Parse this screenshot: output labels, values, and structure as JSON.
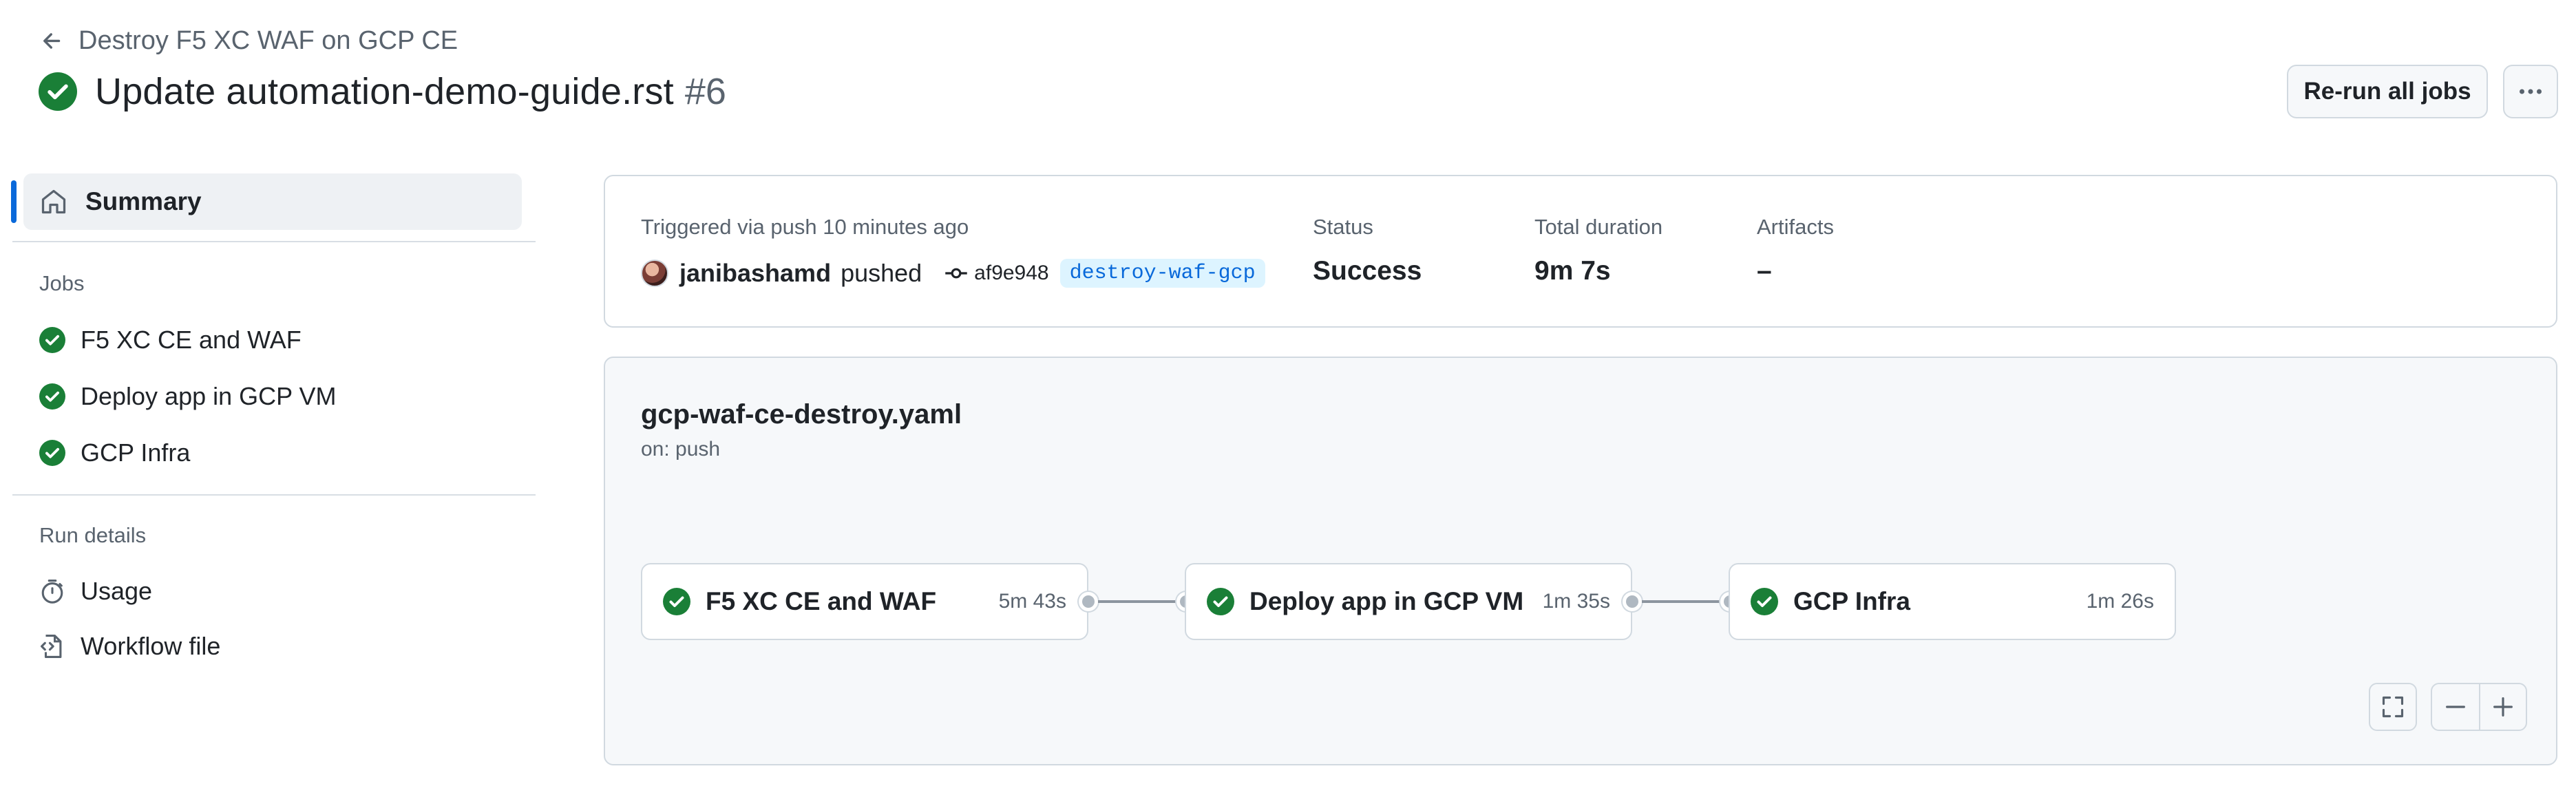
{
  "header": {
    "back_label": "Destroy F5 XC WAF on GCP CE",
    "title": "Update automation-demo-guide.rst",
    "run_number": "#6",
    "rerun_label": "Re-run all jobs"
  },
  "sidebar": {
    "summary_label": "Summary",
    "jobs_heading": "Jobs",
    "jobs": [
      {
        "label": "F5 XC CE and WAF"
      },
      {
        "label": "Deploy app in GCP VM"
      },
      {
        "label": "GCP Infra"
      }
    ],
    "run_details_heading": "Run details",
    "usage_label": "Usage",
    "workflow_file_label": "Workflow file"
  },
  "summary": {
    "trigger_text": "Triggered via push 10 minutes ago",
    "user": "janibashamd",
    "action": "pushed",
    "commit": "af9e948",
    "branch": "destroy-waf-gcp",
    "status_label": "Status",
    "status_value": "Success",
    "duration_label": "Total duration",
    "duration_value": "9m 7s",
    "artifacts_label": "Artifacts",
    "artifacts_value": "–"
  },
  "workflow": {
    "file": "gcp-waf-ce-destroy.yaml",
    "trigger": "on: push",
    "jobs": [
      {
        "name": "F5 XC CE and WAF",
        "time": "5m 43s"
      },
      {
        "name": "Deploy app in GCP VM",
        "time": "1m 35s"
      },
      {
        "name": "GCP Infra",
        "time": "1m 26s"
      }
    ]
  },
  "colors": {
    "success": "#1a7f37",
    "accent": "#0969da",
    "border": "#d1d9e0",
    "muted": "#59636e"
  },
  "icons": [
    "arrow-left-icon",
    "check-circle-icon",
    "kebab-icon",
    "home-icon",
    "stopwatch-icon",
    "workflow-file-icon",
    "commit-icon",
    "fullscreen-icon",
    "zoom-out-icon",
    "zoom-in-icon"
  ]
}
